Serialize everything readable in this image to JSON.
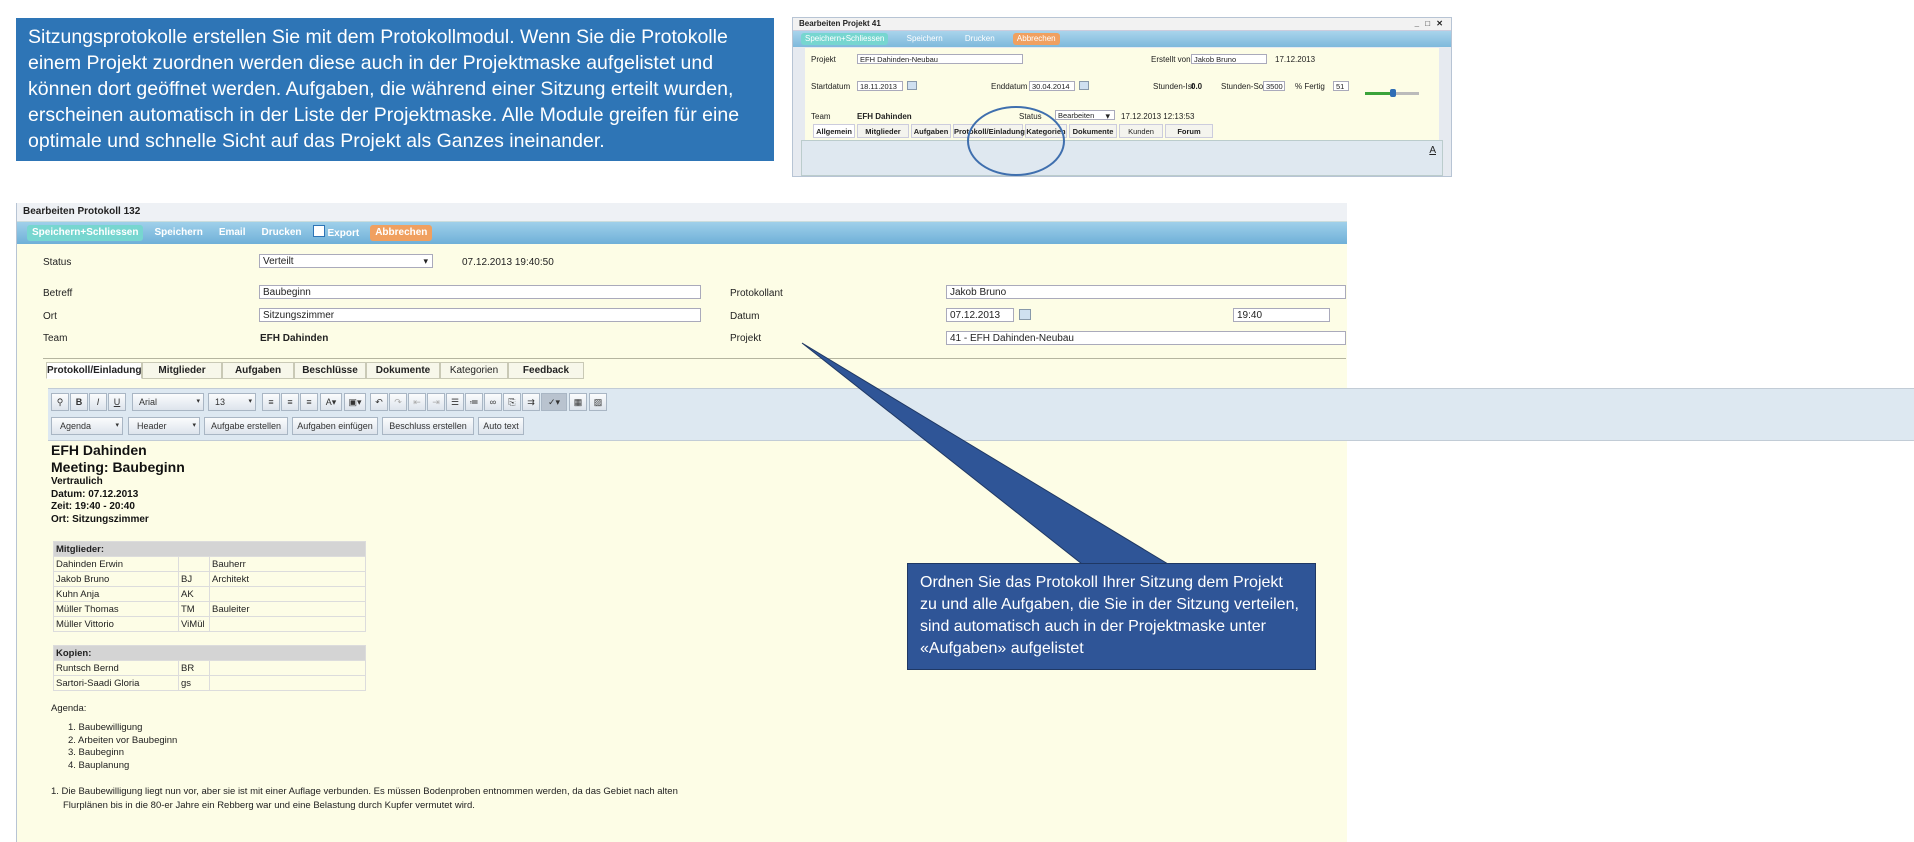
{
  "callouts": {
    "top": "Sitzungsprotokolle erstellen Sie mit dem Protokollmodul. Wenn Sie die Protokolle einem Projekt zuordnen werden diese auch in der Projektmaske aufgelistet und können dort geöffnet werden. Aufgaben, die während einer Sitzung erteilt wurden, erscheinen automatisch in der Liste der Projektmaske. Alle Module greifen für eine optimale und schnelle Sicht auf das Projekt als Ganzes ineinander.",
    "bottom": "Ordnen Sie das Protokoll Ihrer Sitzung dem Projekt zu und alle Aufgaben, die Sie in der Sitzung verteilen, sind automatisch auch in der Projektmaske unter «Aufgaben» aufgelistet"
  },
  "project_window": {
    "title": "Bearbeiten Projekt 41",
    "window_controls": "_ □ ✕",
    "toolbar": {
      "save_close": "Speichern+Schliessen",
      "save": "Speichern",
      "print": "Drucken",
      "cancel": "Abbrechen"
    },
    "labels": {
      "projekt": "Projekt",
      "erstellt_von": "Erstellt von",
      "startdatum": "Startdatum",
      "enddatum": "Enddatum",
      "stunden_ist": "Stunden-Ist",
      "stunden_soll": "Stunden-Soll",
      "fertig": "% Fertig",
      "team": "Team",
      "status": "Status"
    },
    "values": {
      "projekt": "EFH Dahinden-Neubau",
      "erstellt_von": "Jakob Bruno",
      "erstellt_datum": "17.12.2013",
      "startdatum": "18.11.2013",
      "enddatum": "30.04.2014",
      "stunden_ist": "0.0",
      "stunden_soll": "3500",
      "fertig": "51",
      "team": "EFH Dahinden",
      "status": "Bearbeiten",
      "status_time": "17.12.2013 12:13:53"
    },
    "progress_fraction": 0.51,
    "tabs": [
      "Allgemein",
      "Mitglieder",
      "Aufgaben",
      "Protokoll/Einladung",
      "Kategorien",
      "Dokumente",
      "Kunden",
      "Forum"
    ],
    "editor_glyph": "A"
  },
  "protocol_window": {
    "title": "Bearbeiten Protokoll 132",
    "toolbar": {
      "save_close": "Speichern+Schliessen",
      "save": "Speichern",
      "email": "Email",
      "print": "Drucken",
      "export": "Export",
      "cancel": "Abbrechen"
    },
    "fields": {
      "status_label": "Status",
      "status_value": "Verteilt",
      "status_time": "07.12.2013 19:40:50",
      "betreff_label": "Betreff",
      "betreff_value": "Baubeginn",
      "ort_label": "Ort",
      "ort_value": "Sitzungszimmer",
      "team_label": "Team",
      "team_value": "EFH Dahinden",
      "protokollant_label": "Protokollant",
      "protokollant_value": "Jakob Bruno",
      "datum_label": "Datum",
      "datum_value": "07.12.2013",
      "zeit_value": "19:40",
      "projekt_label": "Projekt",
      "projekt_value": "41 - EFH Dahinden-Neubau"
    },
    "tabs": [
      "Protokoll/Einladung",
      "Mitglieder",
      "Aufgaben",
      "Beschlüsse",
      "Dokumente",
      "Kategorien",
      "Feedback"
    ],
    "editor": {
      "font": "Arial",
      "size": "13",
      "agenda_select": "Agenda",
      "header_select": "Header",
      "buttons": [
        "Aufgabe erstellen",
        "Aufgaben einfügen",
        "Beschluss erstellen",
        "Auto text"
      ],
      "format_icons": {
        "bold": "B",
        "italic": "I",
        "underline": "U"
      }
    },
    "document": {
      "heading1": "EFH Dahinden",
      "heading2": "Meeting: Baubeginn",
      "confidential": "Vertraulich",
      "date": "Datum: 07.12.2013",
      "time": "Zeit: 19:40 - 20:40",
      "place": "Ort: Sitzungszimmer",
      "members_header": "Mitglieder:",
      "members": [
        [
          "Dahinden Erwin",
          "",
          "Bauherr"
        ],
        [
          "Jakob Bruno",
          "BJ",
          "Architekt"
        ],
        [
          "Kuhn Anja",
          "AK",
          ""
        ],
        [
          "Müller Thomas",
          "TM",
          "Bauleiter"
        ],
        [
          "Müller Vittorio",
          "ViMül",
          ""
        ]
      ],
      "copies_header": "Kopien:",
      "copies": [
        [
          "Runtsch Bernd",
          "BR",
          ""
        ],
        [
          "Sartori-Saadi Gloria",
          "gs",
          ""
        ]
      ],
      "agenda_label": "Agenda:",
      "agenda_items": [
        "1.  Baubewilligung",
        "2.  Arbeiten vor Baubeginn",
        "3.  Baubeginn",
        "4.  Bauplanung"
      ],
      "paragraph_1": "1. Die Baubewilligung liegt nun vor, aber sie ist mit einer Auflage verbunden. Es müssen Bodenproben entnommen werden, da das Gebiet nach alten",
      "paragraph_2": "Flurplänen bis in die 80-er Jahre ein Rebberg war und eine Belastung durch Kupfer vermutet wird."
    }
  }
}
